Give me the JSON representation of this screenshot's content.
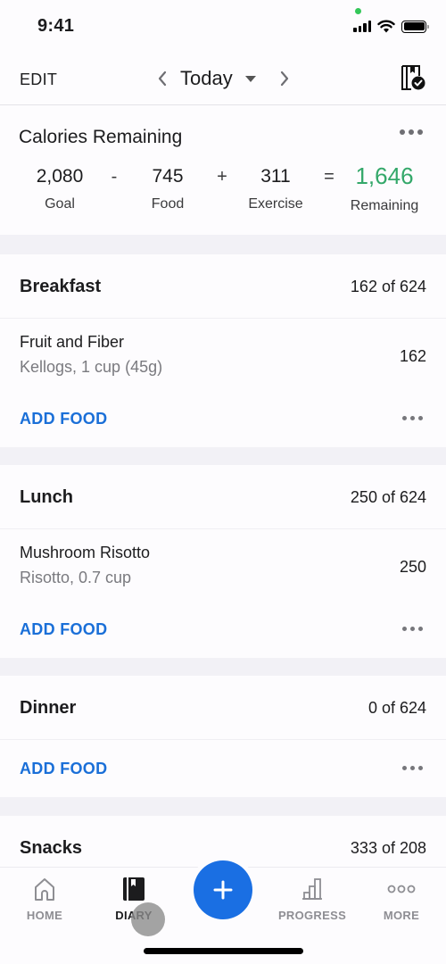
{
  "status_bar": {
    "time": "9:41",
    "icons": [
      "signal-icon",
      "wifi-icon",
      "battery-icon"
    ]
  },
  "nav": {
    "edit_label": "EDIT",
    "date_label": "Today",
    "icons": {
      "prev": "chevron-left-icon",
      "next": "chevron-right-icon",
      "dropdown": "caret-down-icon",
      "complete": "complete-diary-icon"
    }
  },
  "calories": {
    "title": "Calories Remaining",
    "goal": {
      "value": "2,080",
      "label": "Goal"
    },
    "minus": "-",
    "food": {
      "value": "745",
      "label": "Food"
    },
    "plus": "+",
    "exercise": {
      "value": "311",
      "label": "Exercise"
    },
    "equals": "=",
    "remaining": {
      "value": "1,646",
      "label": "Remaining"
    },
    "remaining_color": "#34a86a"
  },
  "meals": [
    {
      "name": "Breakfast",
      "total": "162 of 624",
      "items": [
        {
          "name": "Fruit and Fiber",
          "desc": "Kellogs, 1 cup (45g)",
          "calories": "162"
        }
      ],
      "add_label": "ADD FOOD"
    },
    {
      "name": "Lunch",
      "total": "250 of 624",
      "items": [
        {
          "name": "Mushroom Risotto",
          "desc": "Risotto, 0.7 cup",
          "calories": "250"
        }
      ],
      "add_label": "ADD FOOD"
    },
    {
      "name": "Dinner",
      "total": "0 of 624",
      "items": [],
      "add_label": "ADD FOOD"
    },
    {
      "name": "Snacks",
      "total": "333 of 208",
      "items": [],
      "add_label": ""
    }
  ],
  "tab_bar": {
    "tabs": [
      {
        "label": "HOME",
        "icon": "home-icon",
        "active": false
      },
      {
        "label": "DIARY",
        "icon": "diary-icon",
        "active": true
      },
      {
        "label": "PROGRESS",
        "icon": "progress-chart-icon",
        "active": false
      },
      {
        "label": "MORE",
        "icon": "more-icon",
        "active": false
      }
    ],
    "fab_icon": "plus-icon"
  },
  "colors": {
    "accent_blue": "#1a6fe3",
    "link_blue": "#1a6fd8",
    "success_green": "#34a86a",
    "background": "#f2f1f6"
  }
}
